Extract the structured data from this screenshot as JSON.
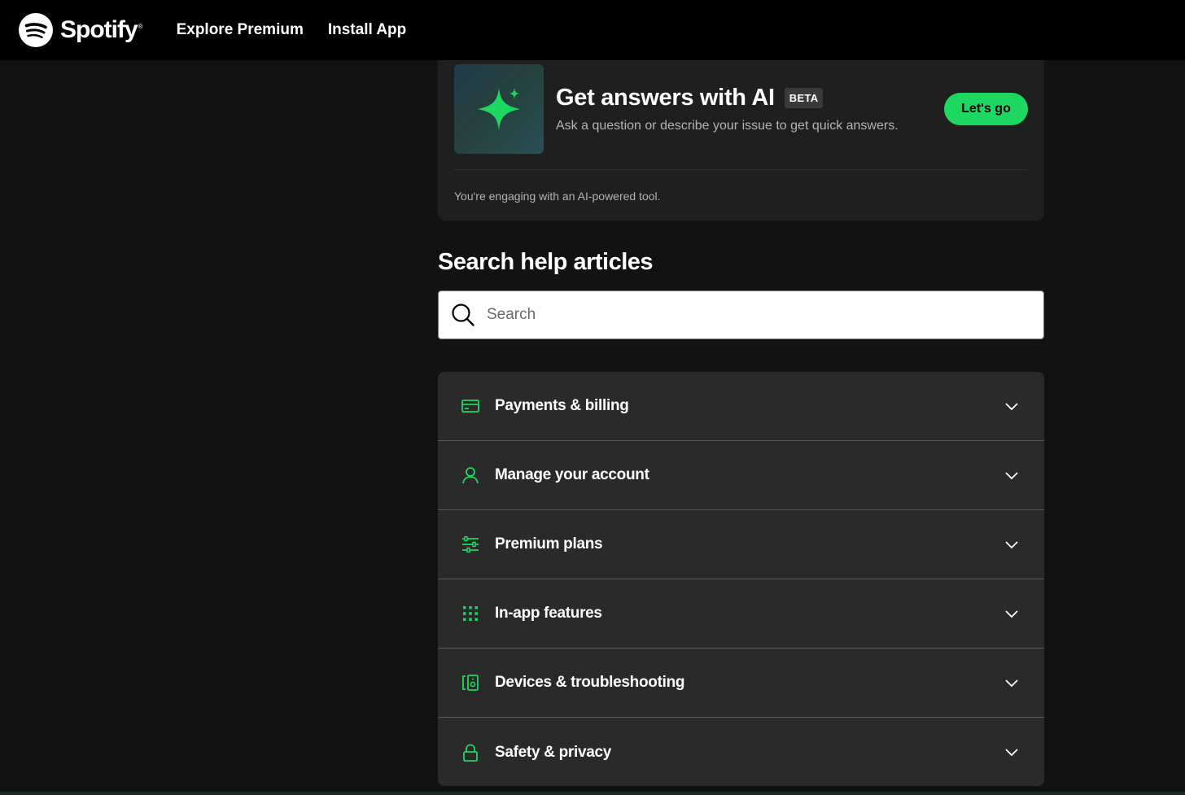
{
  "brand": {
    "name": "Spotify",
    "trademark": "®"
  },
  "nav": {
    "explore_premium": "Explore Premium",
    "install_app": "Install App"
  },
  "ai_card": {
    "title": "Get answers with AI",
    "badge": "BETA",
    "subtitle": "Ask a question or describe your issue to get quick answers.",
    "button": "Let's go",
    "note": "You're engaging with an AI-powered tool."
  },
  "search": {
    "heading": "Search help articles",
    "placeholder": "Search"
  },
  "topics": [
    {
      "label": "Payments & billing",
      "icon": "credit-card-icon"
    },
    {
      "label": "Manage your account",
      "icon": "user-icon"
    },
    {
      "label": "Premium plans",
      "icon": "sliders-icon"
    },
    {
      "label": "In-app features",
      "icon": "grid-icon"
    },
    {
      "label": "Devices & troubleshooting",
      "icon": "devices-icon"
    },
    {
      "label": "Safety & privacy",
      "icon": "lock-icon"
    }
  ],
  "colors": {
    "accent": "#1ed760",
    "background": "#121212",
    "topbar": "#000000",
    "card": "#1f1f1f",
    "accordion": "#2a2a2a"
  }
}
